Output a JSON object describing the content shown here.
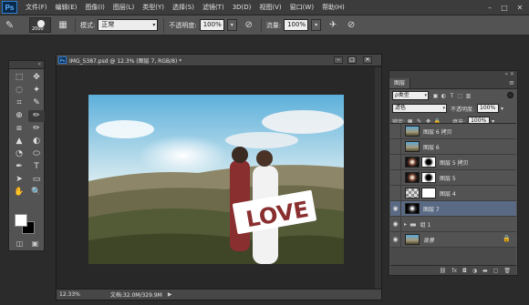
{
  "app": {
    "logo": "Ps"
  },
  "menu": [
    "文件(F)",
    "编辑(E)",
    "图像(I)",
    "图层(L)",
    "类型(Y)",
    "选择(S)",
    "滤镜(T)",
    "3D(D)",
    "视图(V)",
    "窗口(W)",
    "帮助(H)"
  ],
  "window_controls": {
    "minimize": "–",
    "maximize": "□",
    "close": "✕"
  },
  "options": {
    "brush_size": "2000",
    "mode_label": "模式:",
    "mode_value": "正常",
    "opacity_label": "不透明度:",
    "opacity_value": "100%",
    "flow_label": "流量:",
    "flow_value": "100%"
  },
  "tools": [
    "⬚",
    "✥",
    "◌",
    "✦",
    "⌗",
    "✎",
    "⊕",
    "✏",
    "⧈",
    "✏",
    "▲",
    "◐",
    "◔",
    "⬭",
    "✒",
    "T",
    "➤",
    "▭",
    "✋",
    "🔍"
  ],
  "document": {
    "title": "IMG_5387.psd @ 12.3% (图层 7, RGB/8) *",
    "zoom": "12.33%",
    "info": "文档:32.0M/329.9M",
    "photo_text": "LOVE"
  },
  "layers_panel": {
    "tab": "图层",
    "filter_kind": "ρ类型",
    "blend_mode": "滤色",
    "opacity_label": "不透明度:",
    "opacity_value": "100%",
    "lock_label": "锁定:",
    "fill_label": "填充:",
    "fill_value": "100%",
    "layers": [
      {
        "name": "图层 6 拷贝",
        "visible": false,
        "selected": false,
        "thumb": "photo"
      },
      {
        "name": "图层 6",
        "visible": false,
        "selected": false,
        "thumb": "photo"
      },
      {
        "name": "图层 5 拷贝",
        "visible": false,
        "selected": false,
        "thumb": "flare"
      },
      {
        "name": "图层 5",
        "visible": false,
        "selected": false,
        "thumb": "flare"
      },
      {
        "name": "图层 4",
        "visible": false,
        "selected": false,
        "thumb": "grid"
      },
      {
        "name": "图层 7",
        "visible": true,
        "selected": true,
        "thumb": "dark"
      },
      {
        "name": "组 1",
        "visible": true,
        "selected": false,
        "thumb": "group"
      },
      {
        "name": "背景",
        "visible": true,
        "selected": false,
        "thumb": "photo"
      }
    ],
    "footer_icons": [
      "link-icon",
      "fx-icon",
      "mask-icon",
      "adjustment-icon",
      "folder-icon",
      "new-layer-icon",
      "trash-icon"
    ],
    "footer_glyphs": [
      "⛓",
      "fx",
      "◘",
      "◑",
      "▬",
      "▢",
      "🗑"
    ]
  }
}
